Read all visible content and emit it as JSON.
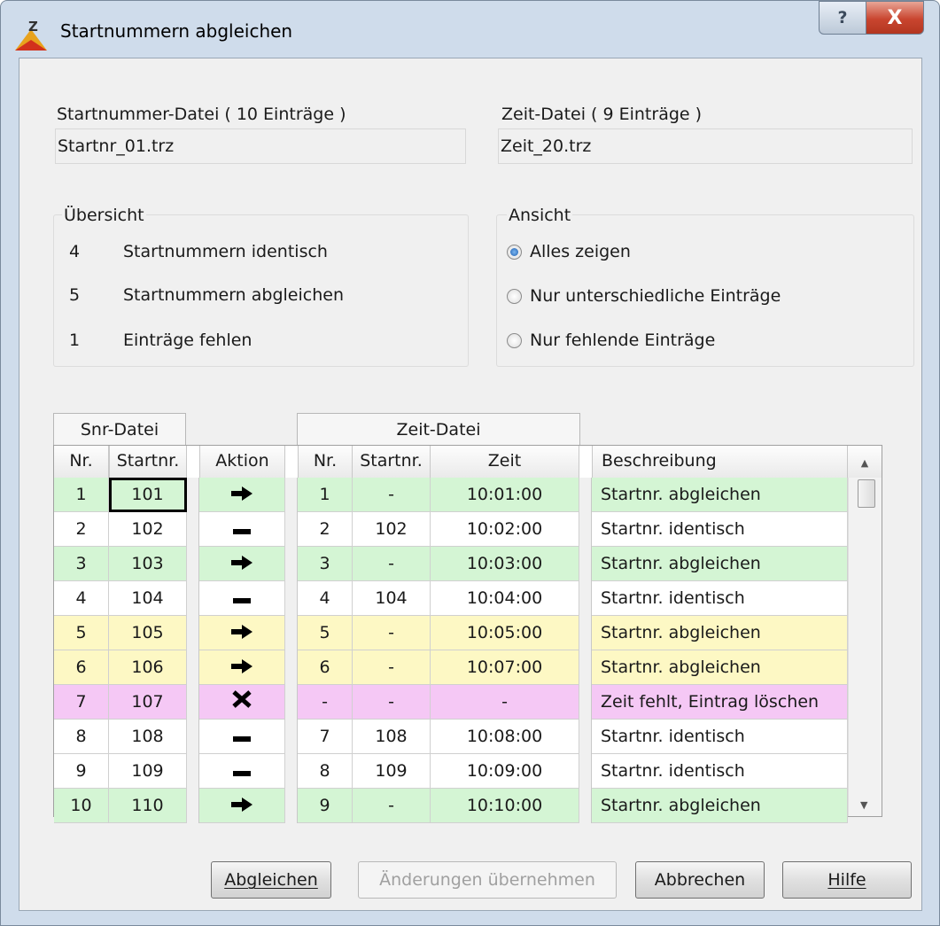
{
  "window": {
    "title": "Startnummern abgleichen",
    "help_glyph": "?",
    "close_glyph": "X"
  },
  "files": {
    "snr_label": "Startnummer-Datei ( 10 Einträge )",
    "snr_value": "Startnr_01.trz",
    "zeit_label": "Zeit-Datei ( 9 Einträge )",
    "zeit_value": "Zeit_20.trz"
  },
  "overview": {
    "title": "Übersicht",
    "items": [
      {
        "count": "4",
        "label": "Startnummern identisch"
      },
      {
        "count": "5",
        "label": "Startnummern abgleichen"
      },
      {
        "count": "1",
        "label": "Einträge fehlen"
      }
    ]
  },
  "view": {
    "title": "Ansicht",
    "options": [
      {
        "label": "Alles zeigen",
        "selected": true
      },
      {
        "label": "Nur unterschiedliche Einträge",
        "selected": false
      },
      {
        "label": "Nur fehlende Einträge",
        "selected": false
      }
    ]
  },
  "table": {
    "band_snr": "Snr-Datei",
    "band_zeit": "Zeit-Datei",
    "headers": {
      "nr": "Nr.",
      "startnr": "Startnr.",
      "aktion": "Aktion",
      "zeit": "Zeit",
      "beschreibung": "Beschreibung"
    },
    "colors": {
      "green": "#d4f5d4",
      "yellow": "#fdf8c4",
      "pink": "#f5c8f5",
      "white": "#ffffff"
    },
    "rows": [
      {
        "nr": "1",
        "startnr": "101",
        "action": "arrow",
        "z_nr": "1",
        "z_startnr": "-",
        "zeit": "10:01:00",
        "desc": "Startnr. abgleichen",
        "color": "green"
      },
      {
        "nr": "2",
        "startnr": "102",
        "action": "dash",
        "z_nr": "2",
        "z_startnr": "102",
        "zeit": "10:02:00",
        "desc": "Startnr. identisch",
        "color": "white"
      },
      {
        "nr": "3",
        "startnr": "103",
        "action": "arrow",
        "z_nr": "3",
        "z_startnr": "-",
        "zeit": "10:03:00",
        "desc": "Startnr. abgleichen",
        "color": "green"
      },
      {
        "nr": "4",
        "startnr": "104",
        "action": "dash",
        "z_nr": "4",
        "z_startnr": "104",
        "zeit": "10:04:00",
        "desc": "Startnr. identisch",
        "color": "white"
      },
      {
        "nr": "5",
        "startnr": "105",
        "action": "arrow",
        "z_nr": "5",
        "z_startnr": "-",
        "zeit": "10:05:00",
        "desc": "Startnr. abgleichen",
        "color": "yellow"
      },
      {
        "nr": "6",
        "startnr": "106",
        "action": "arrow",
        "z_nr": "6",
        "z_startnr": "-",
        "zeit": "10:07:00",
        "desc": "Startnr. abgleichen",
        "color": "yellow"
      },
      {
        "nr": "7",
        "startnr": "107",
        "action": "cross",
        "z_nr": "-",
        "z_startnr": "-",
        "zeit": "-",
        "desc": "Zeit fehlt, Eintrag löschen",
        "color": "pink"
      },
      {
        "nr": "8",
        "startnr": "108",
        "action": "dash",
        "z_nr": "7",
        "z_startnr": "108",
        "zeit": "10:08:00",
        "desc": "Startnr. identisch",
        "color": "white"
      },
      {
        "nr": "9",
        "startnr": "109",
        "action": "dash",
        "z_nr": "8",
        "z_startnr": "109",
        "zeit": "10:09:00",
        "desc": "Startnr. identisch",
        "color": "white"
      },
      {
        "nr": "10",
        "startnr": "110",
        "action": "arrow",
        "z_nr": "9",
        "z_startnr": "-",
        "zeit": "10:10:00",
        "desc": "Startnr. abgleichen",
        "color": "green"
      }
    ]
  },
  "buttons": {
    "abgleichen": "Abgleichen",
    "uebernehmen": "Änderungen übernehmen",
    "abbrechen": "Abbrechen",
    "hilfe": "Hilfe"
  }
}
